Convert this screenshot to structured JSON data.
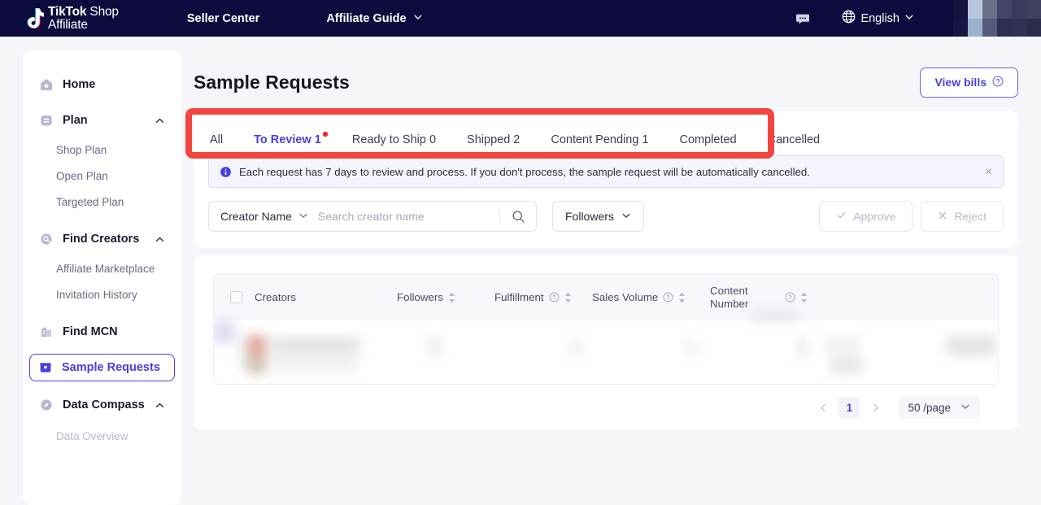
{
  "topnav": {
    "brand_line1_bold": "TikTok",
    "brand_line1_thin": " Shop",
    "brand_line2": "Affiliate",
    "seller_center": "Seller Center",
    "affiliate_guide": "Affiliate Guide",
    "language": "English",
    "chat_icon": "chat-bubble-icon",
    "globe_icon": "globe-icon",
    "avatar": "blurred-avatar-mosaic",
    "bg_color": "#0d0b3d"
  },
  "sidebar": {
    "items": [
      {
        "label": "Home",
        "icon": "home-icon",
        "type": "top",
        "expandable": false
      },
      {
        "label": "Plan",
        "icon": "plan-icon",
        "type": "top",
        "expandable": true
      },
      {
        "label": "Shop Plan",
        "type": "sub"
      },
      {
        "label": "Open Plan",
        "type": "sub"
      },
      {
        "label": "Targeted Plan",
        "type": "sub"
      },
      {
        "label": "Find Creators",
        "icon": "search-circle-icon",
        "type": "top",
        "expandable": true
      },
      {
        "label": "Affiliate Marketplace",
        "type": "sub"
      },
      {
        "label": "Invitation History",
        "type": "sub"
      },
      {
        "label": "Find MCN",
        "icon": "building-icon",
        "type": "top",
        "expandable": false
      },
      {
        "label": "Sample Requests",
        "icon": "sample-box-icon",
        "type": "top",
        "expandable": false,
        "active": true,
        "badge_dot": true
      },
      {
        "label": "Data Compass",
        "icon": "compass-icon",
        "type": "top",
        "expandable": true
      },
      {
        "label": "Data Overview",
        "type": "sub-partial"
      }
    ],
    "active_color": "#4a3fe0",
    "badge_color": "#f0252b"
  },
  "page": {
    "title": "Sample Requests",
    "view_bills_label": "View bills",
    "view_bills_help_icon": "question-circle-icon"
  },
  "tabs": {
    "items": [
      {
        "label": "All",
        "active": false
      },
      {
        "label": "To Review 1",
        "active": true,
        "dot": true
      },
      {
        "label": "Ready to Ship 0",
        "active": false
      },
      {
        "label": "Shipped 2",
        "active": false
      },
      {
        "label": "Content Pending 1",
        "active": false
      },
      {
        "label": "Completed",
        "active": false
      },
      {
        "label": "Cancelled",
        "active": false
      }
    ],
    "annotation_color": "#f2453d"
  },
  "banner": {
    "icon": "info-circle-icon",
    "text": "Each request has 7 days to review and process. If you don't process, the sample request will be automatically cancelled.",
    "close_label": "×"
  },
  "filters": {
    "field_select": "Creator Name",
    "search_placeholder": "Search creator name",
    "search_value": "",
    "search_icon": "search-icon",
    "followers_filter": "Followers",
    "approve_label": "Approve",
    "approve_icon": "check-icon",
    "reject_label": "Reject",
    "reject_icon": "x-icon",
    "actions_disabled": true
  },
  "table": {
    "columns": [
      {
        "label": "Creators",
        "sortable": false,
        "help": false
      },
      {
        "label": "Followers",
        "sortable": true,
        "help": false
      },
      {
        "label": "Fulfillment",
        "sortable": true,
        "help": true
      },
      {
        "label": "Sales Volume",
        "sortable": true,
        "help": true
      },
      {
        "label": "Content Number",
        "sortable": true,
        "help": true
      }
    ],
    "rows_redacted": true
  },
  "pagination": {
    "prev_icon": "chevron-left-icon",
    "next_icon": "chevron-right-icon",
    "current_page": "1",
    "page_size": "50 /page"
  }
}
